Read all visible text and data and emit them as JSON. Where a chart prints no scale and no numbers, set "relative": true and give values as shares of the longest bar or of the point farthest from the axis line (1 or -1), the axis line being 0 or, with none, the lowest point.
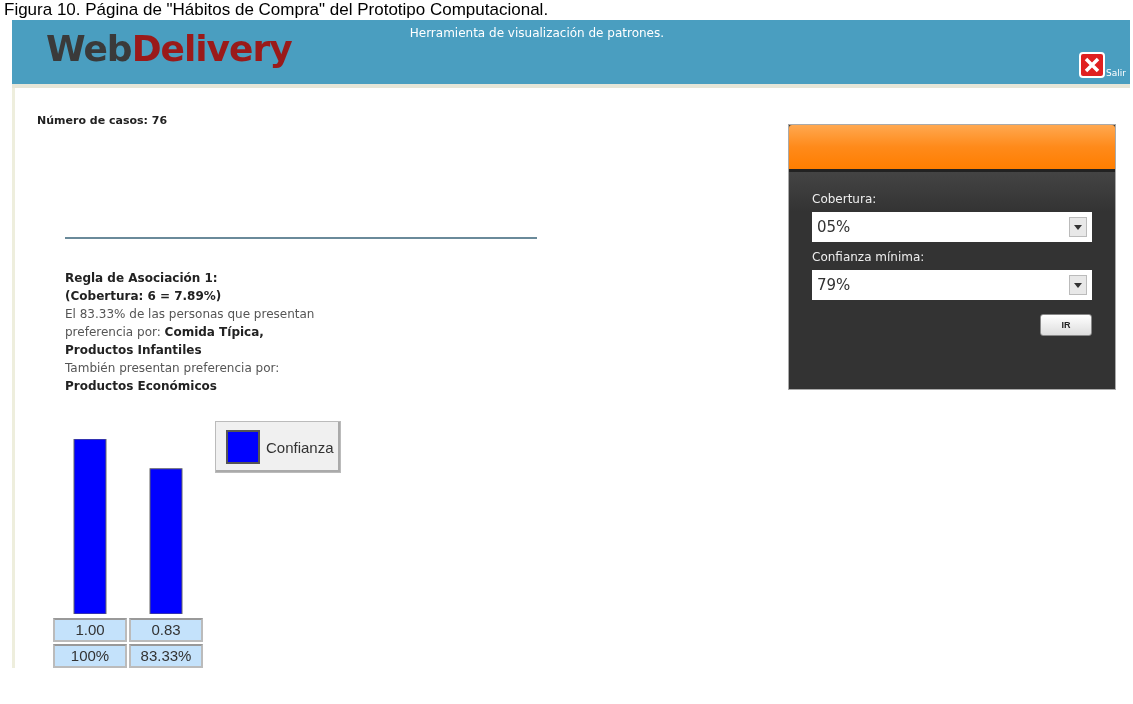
{
  "caption": "Figura 10. Página de \"Hábitos de Compra\" del Prototipo Computacional.",
  "header": {
    "logo_first": "Web",
    "logo_second": "Delivery",
    "subtitle": "Herramienta de visualización de patrones.",
    "exit_label": "Salir"
  },
  "case_count": "Número de casos: 76",
  "rule": {
    "title": "Regla de Asociación 1:",
    "coverage": "(Cobertura: 6 = 7.89%)",
    "sentence": "El 83.33% de las personas que presentan preferencia por: **Comida Típica, Productos Infantiles**",
    "also": "También presentan preferencia por:",
    "consequent": "Productos Económicos"
  },
  "chart_data": {
    "type": "bar",
    "series": [
      {
        "name": "Confianza",
        "color": "#0000ff",
        "values": [
          1.0,
          0.83
        ]
      }
    ],
    "relative": true,
    "value_labels": [
      "1.00",
      "0.83"
    ]
  },
  "bar_percent_labels": [
    "100%",
    "83.33%"
  ],
  "filter_panel": {
    "fields": [
      {
        "label": "Cobertura:",
        "value": "05%"
      },
      {
        "label": "Confianza mínima:",
        "value": "79%"
      }
    ],
    "submit": "IR"
  }
}
